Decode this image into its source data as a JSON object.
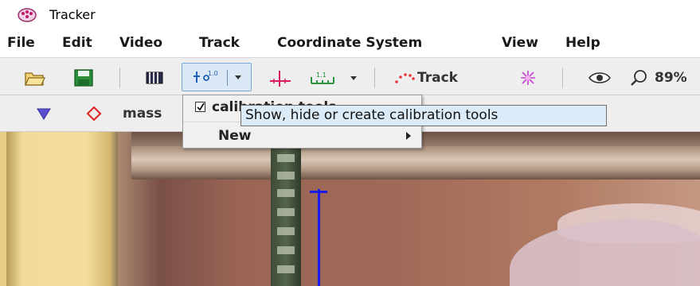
{
  "window": {
    "title": "Tracker",
    "icon": "tracker-app-icon"
  },
  "menubar": {
    "items": [
      {
        "label": "File"
      },
      {
        "label": "Edit"
      },
      {
        "label": "Video"
      },
      {
        "label": "Track"
      },
      {
        "label": "Coordinate System"
      },
      {
        "label": "View"
      },
      {
        "label": "Help"
      }
    ]
  },
  "toolbar": {
    "track_label": "Track",
    "zoom_label": "89%",
    "icons": [
      "open-folder-icon",
      "save-disk-icon",
      "clip-settings-icon",
      "calibration-tools-icon",
      "axes-icon",
      "tape-measure-icon",
      "track-points-icon",
      "sparkle-icon",
      "eye-icon",
      "zoom-magnifier-icon"
    ]
  },
  "trackbar": {
    "track_name": "mass"
  },
  "popup": {
    "visible_item": "calibration tools",
    "new_item": "New",
    "checked": true
  },
  "tooltip": {
    "text": "Show, hide or create calibration tools"
  },
  "colors": {
    "axis": "#1a1aee",
    "tooltip_bg": "#dcebf8",
    "mass_marker": "#e02020",
    "selector": "#5a4fd0"
  }
}
